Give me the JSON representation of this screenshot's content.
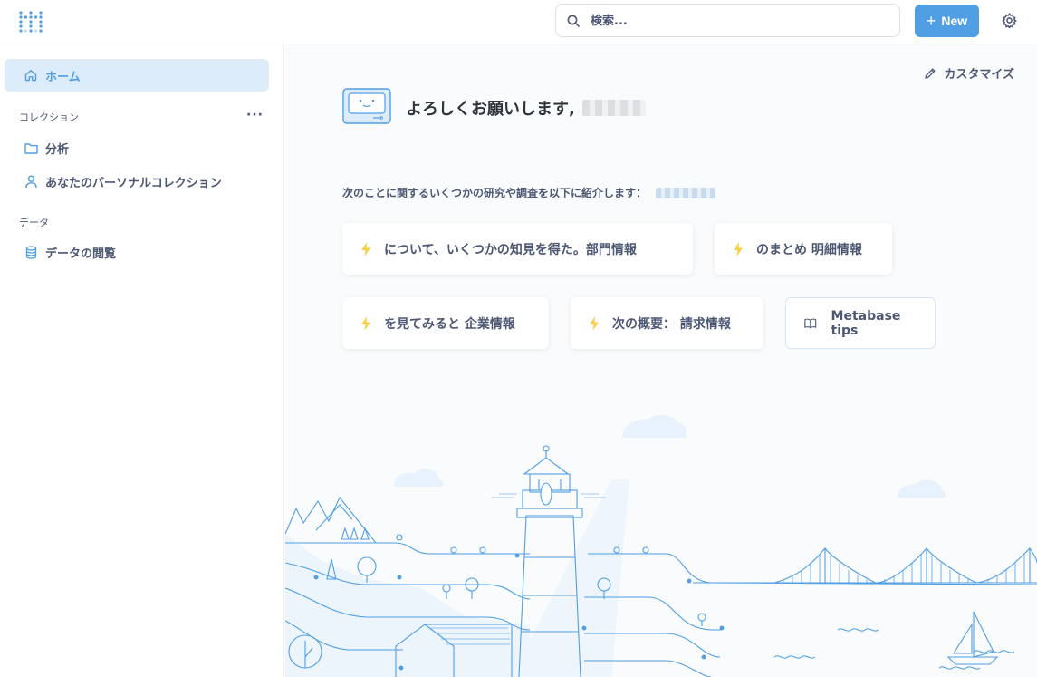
{
  "search": {
    "placeholder": "検索..."
  },
  "header": {
    "new_label": "New"
  },
  "sidebar": {
    "home_label": "ホーム",
    "collections_heading": "コレクション",
    "more_label": "···",
    "collections": [
      {
        "label": "分析"
      },
      {
        "label": "あなたのパーソナルコレクション"
      }
    ],
    "data_heading": "データ",
    "browse_data_label": "データの閲覧"
  },
  "main": {
    "customize_label": "カスタマイズ",
    "greeting": "よろしくお願いします,",
    "intro": "次のことに関するいくつかの研究や調査を以下に紹介します：",
    "xrays": [
      {
        "label": "について、いくつかの知見を得た。部門情報"
      },
      {
        "label": "のまとめ 明細情報"
      },
      {
        "label": "を見てみると 企業情報"
      },
      {
        "label": "次の概要： 請求情報"
      }
    ],
    "tips_label": "Metabase tips"
  },
  "colors": {
    "brand": "#509ee3",
    "sidebar_active_bg": "#ddecfa",
    "text": "#4c5773",
    "bolt": "#f9cf48",
    "illustration": "#509ee3"
  },
  "icons": [
    "metabase-logo-icon",
    "search-icon",
    "plus-icon",
    "gear-icon",
    "home-icon",
    "folder-icon",
    "person-icon",
    "database-icon",
    "pencil-icon",
    "bolt-icon",
    "book-icon"
  ]
}
